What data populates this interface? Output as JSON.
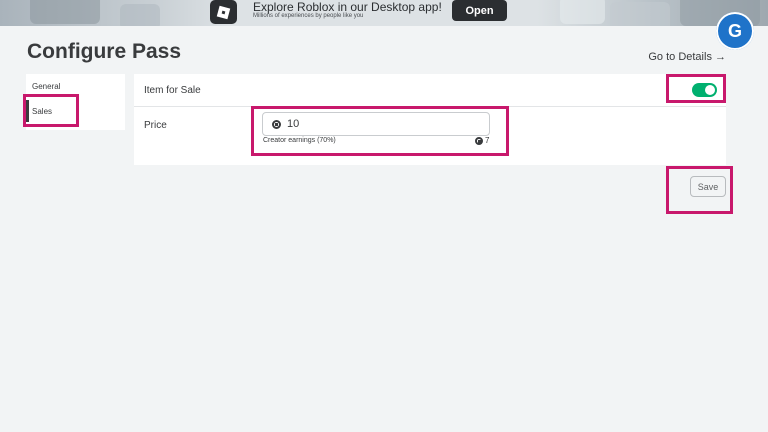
{
  "banner": {
    "title": "Explore Roblox in our Desktop app!",
    "subtitle": "Millions of experiences by people like you",
    "open_label": "Open"
  },
  "watermark": {
    "letter": "G"
  },
  "page": {
    "title": "Configure Pass",
    "go_details": "Go to Details →"
  },
  "sidebar": {
    "items": [
      {
        "label": "General",
        "active": false
      },
      {
        "label": "Sales",
        "active": true
      }
    ]
  },
  "sale": {
    "label": "Item for Sale",
    "enabled": true,
    "toggle_color": "#00b06f"
  },
  "price": {
    "label": "Price",
    "value": "10",
    "earnings_label": "Creator earnings (70%)",
    "earnings_value": "7"
  },
  "save_label": "Save",
  "highlight_color": "#c8186c"
}
